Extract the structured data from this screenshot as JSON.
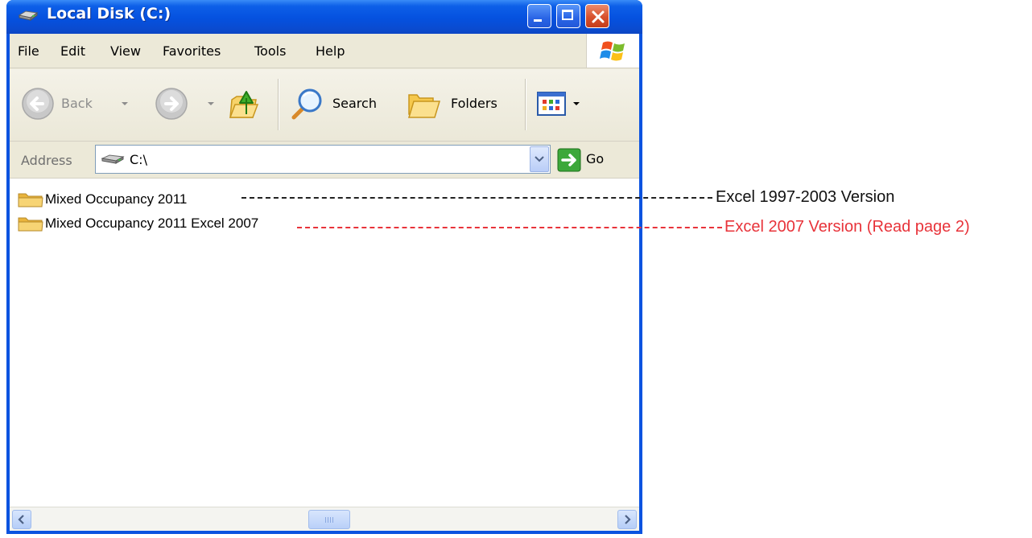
{
  "window": {
    "title": "Local Disk (C:)",
    "colors": {
      "titlebar": "#0a53e0",
      "close_button": "#d8512d",
      "client_bg": "#ece9d8",
      "annotation_red": "#e8333a"
    }
  },
  "menubar": {
    "items": [
      "File",
      "Edit",
      "View",
      "Favorites",
      "Tools",
      "Help"
    ]
  },
  "toolbar": {
    "back_label": "Back",
    "search_label": "Search",
    "folders_label": "Folders"
  },
  "addressbar": {
    "label": "Address",
    "value": "C:\\",
    "go_label": "Go"
  },
  "files": [
    {
      "name": "Mixed Occupancy 2011",
      "icon": "folder-icon"
    },
    {
      "name": "Mixed Occupancy 2011 Excel 2007",
      "icon": "folder-icon"
    }
  ],
  "annotations": [
    {
      "text": "Excel 1997-2003 Version",
      "color": "#111111"
    },
    {
      "text": "Excel 2007 Version (Read page 2)",
      "color": "#e8333a"
    }
  ]
}
